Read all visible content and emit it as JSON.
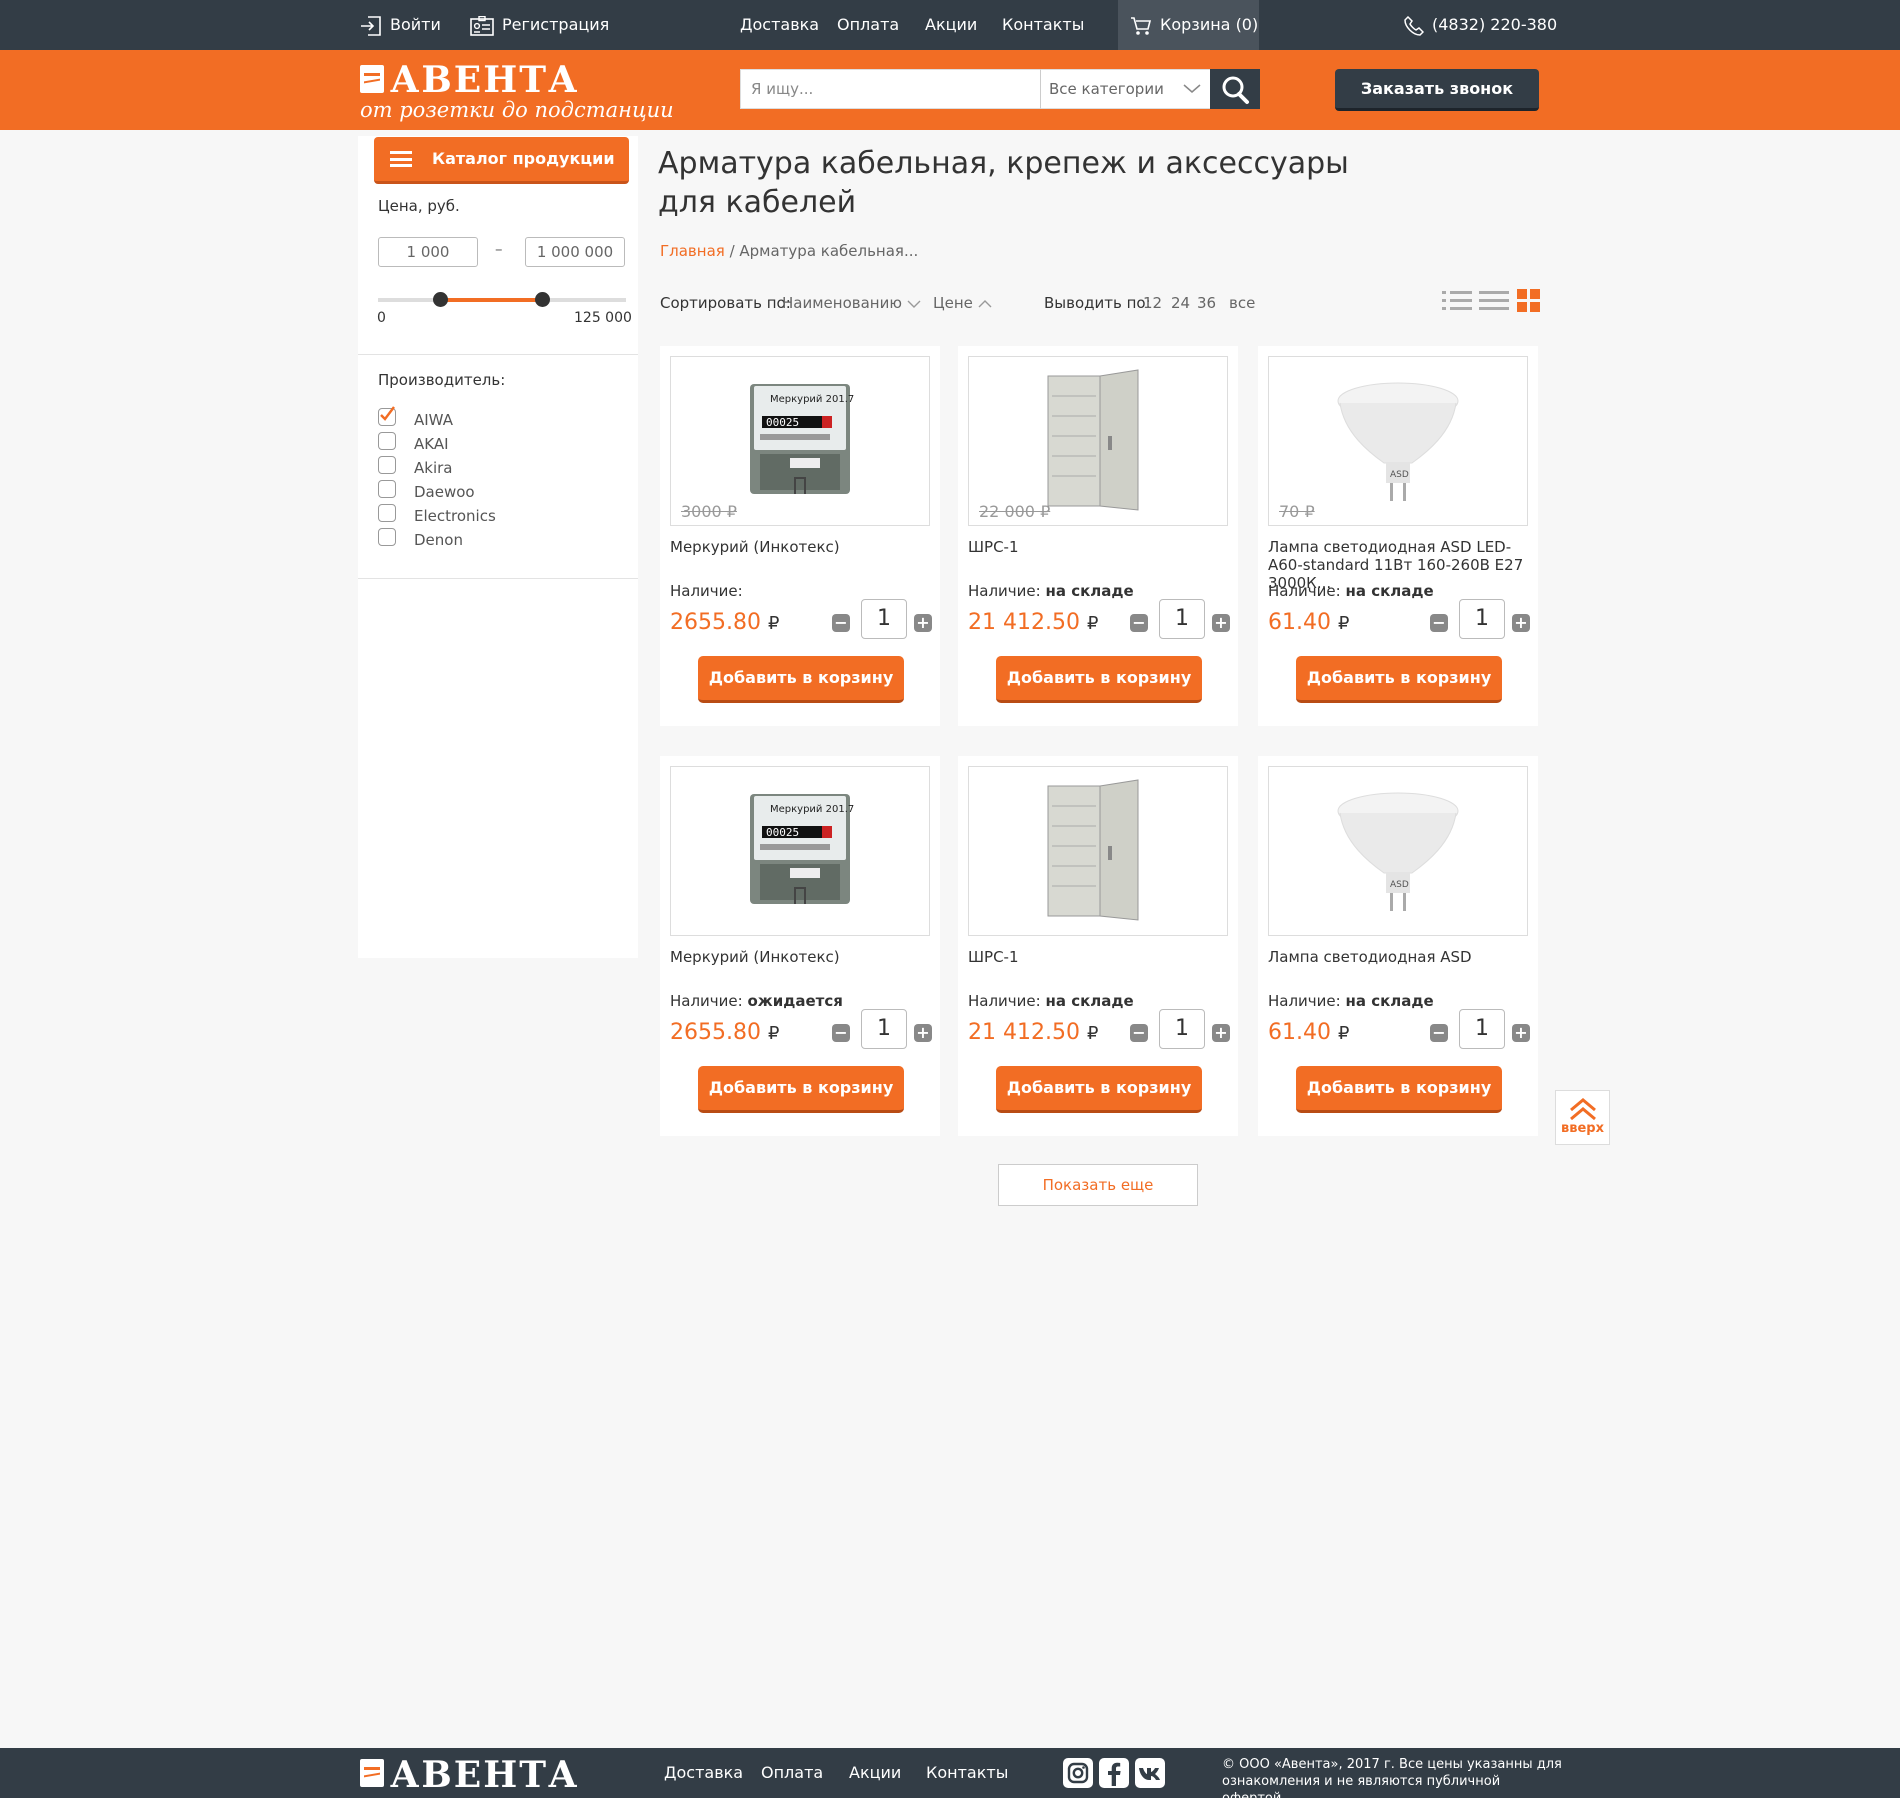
{
  "topbar": {
    "login": "Войти",
    "register": "Регистрация",
    "nav": [
      "Доставка",
      "Оплата",
      "Акции",
      "Контакты"
    ],
    "cart": "Корзина (0)",
    "phone": "(4832) 220-380"
  },
  "header": {
    "logo_text": "АВЕНТА",
    "slogan": "от розетки до подстанции",
    "search_placeholder": "Я ищу...",
    "category_select": "Все категории",
    "call_button": "Заказать звонок"
  },
  "sidebar": {
    "catalog_button": "Каталог продукции",
    "price_label": "Цена, руб.",
    "price_from": "1 000",
    "price_dash": "–",
    "price_to": "1 000 000",
    "range_min_label": "0",
    "range_max_label": "125 000",
    "range_low_fraction": 0.25,
    "range_high_fraction": 0.66,
    "manufacturer_label": "Производитель:",
    "manufacturers": [
      {
        "name": "AIWA",
        "checked": true
      },
      {
        "name": "AKAI",
        "checked": false
      },
      {
        "name": "Akira",
        "checked": false
      },
      {
        "name": "Daewoo",
        "checked": false
      },
      {
        "name": "Electronics",
        "checked": false
      },
      {
        "name": "Denon",
        "checked": false
      }
    ]
  },
  "main": {
    "title_line1": "Арматура кабельная, крепеж и аксессуары",
    "title_line2": "для кабелей",
    "breadcrumb_home": "Главная",
    "breadcrumb_sep": " / ",
    "breadcrumb_current": "Арматура кабельная...",
    "sort_label": "Сортировать по:",
    "sort_name": "Наименованию",
    "sort_price": "Цене",
    "show_label": "Выводить по:",
    "show_options": [
      "12",
      "24",
      "36",
      "все"
    ],
    "show_more": "Показать еще",
    "to_top": "вверх"
  },
  "products": [
    {
      "name": "Меркурий (Инкотекс)",
      "old_price": "3000 ₽",
      "avail_label": "Наличие:",
      "avail": "",
      "price": "2655.80",
      "currency": "₽",
      "qty": "1",
      "add": "Добавить в корзину",
      "image": "meter-icon"
    },
    {
      "name": "ШРС-1",
      "old_price": "22 000 ₽",
      "avail_label": "Наличие:",
      "avail": "на складе",
      "price": "21 412.50",
      "currency": "₽",
      "qty": "1",
      "add": "Добавить в корзину",
      "image": "cabinet-icon"
    },
    {
      "name": "Лампа светодиодная ASD LED-A60-standard 11Вт 160-260В Е27 3000К...",
      "old_price": "70 ₽",
      "avail_label": "Наличие:",
      "avail": "на складе",
      "price": "61.40",
      "currency": "₽",
      "qty": "1",
      "add": "Добавить в корзину",
      "image": "lamp-icon"
    },
    {
      "name": "Меркурий (Инкотекс)",
      "old_price": "",
      "avail_label": "Наличие:",
      "avail": "ожидается",
      "price": "2655.80",
      "currency": "₽",
      "qty": "1",
      "add": "Добавить в корзину",
      "image": "meter-icon"
    },
    {
      "name": "ШРС-1",
      "old_price": "",
      "avail_label": "Наличие:",
      "avail": "на складе",
      "price": "21 412.50",
      "currency": "₽",
      "qty": "1",
      "add": "Добавить в корзину",
      "image": "cabinet-icon"
    },
    {
      "name": "Лампа светодиодная ASD",
      "old_price": "",
      "avail_label": "Наличие:",
      "avail": "на складе",
      "price": "61.40",
      "currency": "₽",
      "qty": "1",
      "add": "Добавить в корзину",
      "image": "lamp-icon"
    }
  ],
  "footer": {
    "logo_text": "АВЕНТА",
    "nav": [
      "Доставка",
      "Оплата",
      "Акции",
      "Контакты"
    ],
    "copyright_line1": "© ООО «Авента», 2017 г. Все цены указанны  для",
    "copyright_line2": "ознакомления и не являются публичной офертой."
  },
  "colors": {
    "accent": "#f26d24",
    "dark": "#333d46"
  }
}
